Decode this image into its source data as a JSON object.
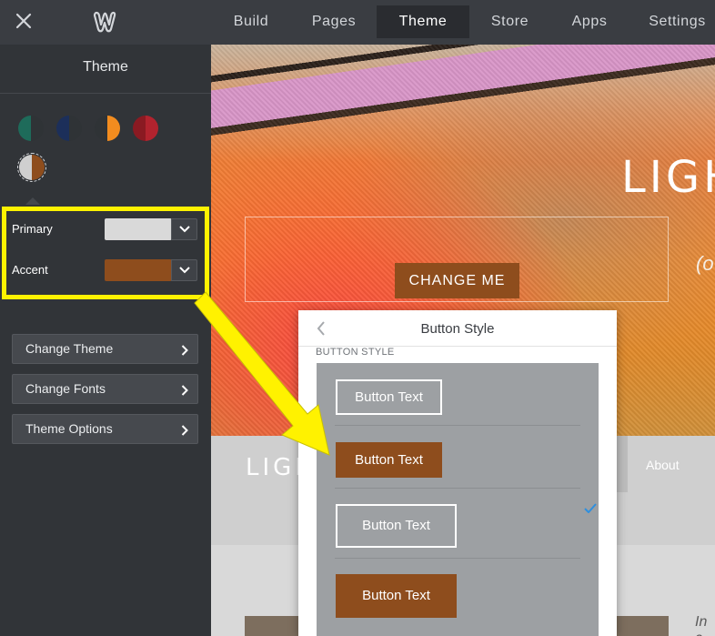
{
  "topbar": {
    "tabs": [
      {
        "label": "Build"
      },
      {
        "label": "Pages"
      },
      {
        "label": "Theme"
      },
      {
        "label": "Store"
      },
      {
        "label": "Apps"
      },
      {
        "label": "Settings"
      }
    ],
    "active_tab": "Theme",
    "close_icon": "close-icon",
    "logo_icon": "weebly-logo"
  },
  "sidebar": {
    "title": "Theme",
    "swatches": [
      {
        "left": "#1e6b5a",
        "right": "#2f3336"
      },
      {
        "left": "#1c2f5a",
        "right": "#2f3336"
      },
      {
        "left": "#2f3336",
        "right": "#f28c1f"
      },
      {
        "left": "#8a1a22",
        "right": "#b2232e"
      },
      {
        "left": "#cfcfcf",
        "right": "#8e4d1d",
        "selected": true
      }
    ],
    "colors": {
      "primary_label": "Primary",
      "primary_value": "#d9d9d9",
      "accent_label": "Accent",
      "accent_value": "#8e4d1d"
    },
    "buttons": [
      {
        "label": "Change Theme"
      },
      {
        "label": "Change Fonts"
      },
      {
        "label": "Theme Options"
      }
    ]
  },
  "canvas": {
    "hero_title": "LIGH",
    "hero_subtitle": "(o",
    "hero_button": "CHANGE ME",
    "nav_logo": "LIGH",
    "nav_about": "About",
    "content_text": "In c"
  },
  "popover": {
    "title": "Button Style",
    "section_label": "BUTTON STYLE",
    "options": [
      {
        "label": "Button Text",
        "style": "outline"
      },
      {
        "label": "Button Text",
        "style": "filled",
        "selected": true
      },
      {
        "label": "Button Text",
        "style": "outline"
      },
      {
        "label": "Button Text",
        "style": "filled"
      }
    ]
  },
  "colors": {
    "accent": "#8e4d1d",
    "highlight": "#fff200",
    "check": "#2f8fde"
  }
}
